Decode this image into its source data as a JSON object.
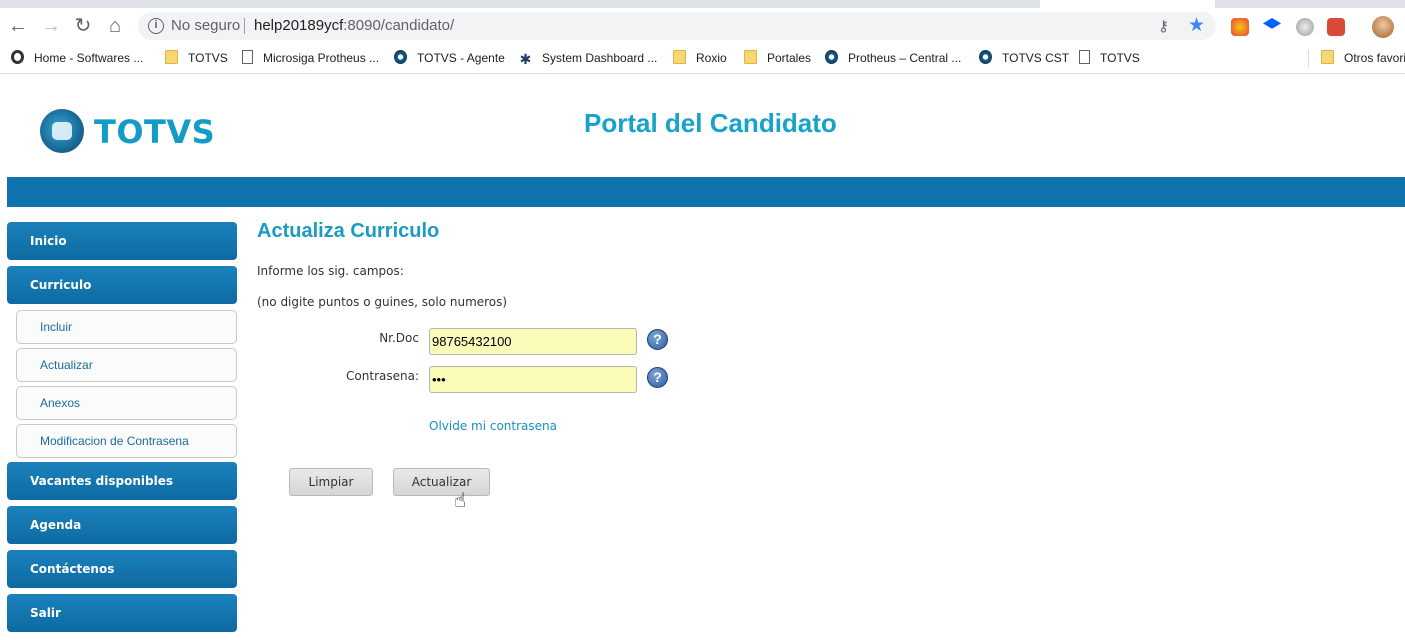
{
  "browser": {
    "security_label": "No seguro",
    "url_host": "help20189ycf",
    "url_rest": ":8090/candidato/"
  },
  "bookmarks": [
    {
      "label": "Home - Softwares ...",
      "icon": "ring-icon"
    },
    {
      "label": "TOTVS",
      "icon": "folder-icon"
    },
    {
      "label": "Microsiga Protheus ...",
      "icon": "page-icon"
    },
    {
      "label": "TOTVS - Agente",
      "icon": "globe-icon"
    },
    {
      "label": "System Dashboard ...",
      "icon": "jira-icon"
    },
    {
      "label": "Roxio",
      "icon": "folder-icon"
    },
    {
      "label": "Portales",
      "icon": "folder-icon"
    },
    {
      "label": "Protheus – Central ...",
      "icon": "globe-icon"
    },
    {
      "label": "TOTVS CST",
      "icon": "globe-icon"
    },
    {
      "label": "TOTVS",
      "icon": "page-icon"
    },
    {
      "label": "Otros favori",
      "icon": "folder-icon"
    }
  ],
  "header": {
    "logo_text": "TOTVS",
    "portal_title": "Portal del Candidato"
  },
  "menu": {
    "inicio": "Inicio",
    "curriculo": "Curriculo",
    "sub": [
      "Incluir",
      "Actualizar",
      "Anexos",
      "Modificacion de Contrasena"
    ],
    "vacantes": "Vacantes disponibles",
    "agenda": "Agenda",
    "contactenos": "Contáctenos",
    "salir": "Salir"
  },
  "form": {
    "title": "Actualiza Curriculo",
    "intro1": "Informe los sig. campos:",
    "intro2": "(no digite puntos o guines, solo numeros)",
    "doc_label": "Nr.Doc",
    "doc_value": "98765432100",
    "pass_label": "Contrasena:",
    "pass_value": "•••",
    "forgot_link": "Olvide mi contrasena",
    "clear_button": "Limpiar",
    "update_button": "Actualizar",
    "help_symbol": "?"
  },
  "colors": {
    "brand_blue": "#0f74ad",
    "title_teal": "#17a2c8",
    "input_yellow": "#fbfbb9"
  }
}
